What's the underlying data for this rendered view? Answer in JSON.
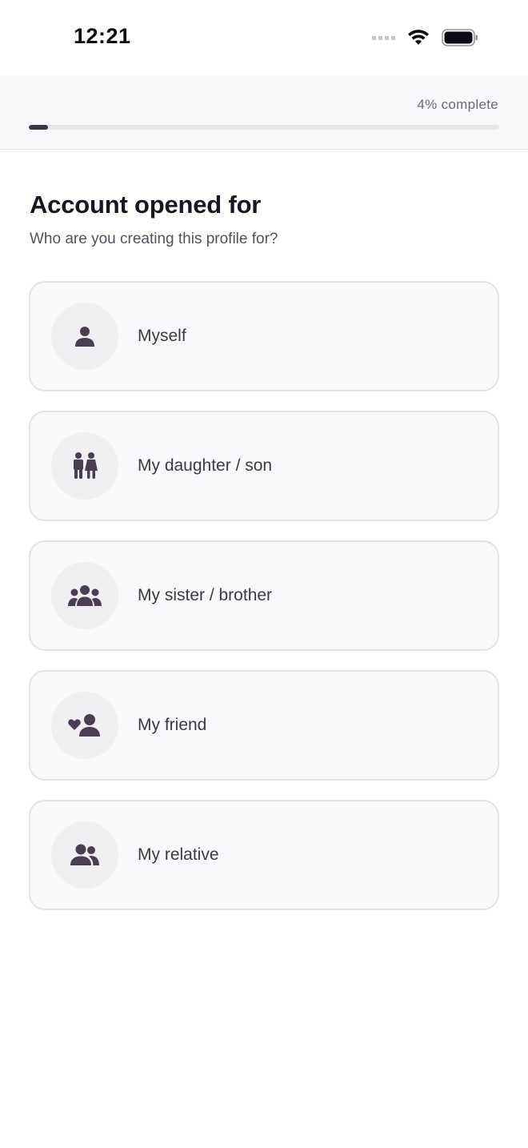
{
  "status_bar": {
    "time": "12:21"
  },
  "progress": {
    "label": "4% complete",
    "percent": 4,
    "fill_color": "#3c3345",
    "track_color": "#e6e6e9"
  },
  "header": {
    "title": "Account opened for",
    "subtitle": "Who are you creating this profile for?"
  },
  "options": [
    {
      "label": "Myself",
      "icon": "person-icon"
    },
    {
      "label": "My daughter / son",
      "icon": "children-icon"
    },
    {
      "label": "My sister / brother",
      "icon": "siblings-group-icon"
    },
    {
      "label": "My friend",
      "icon": "friend-heart-icon"
    },
    {
      "label": "My relative",
      "icon": "relatives-icon"
    }
  ],
  "colors": {
    "icon": "#4a3f52",
    "card_border": "#e3e3e6",
    "card_background": "#f8f9fb"
  }
}
